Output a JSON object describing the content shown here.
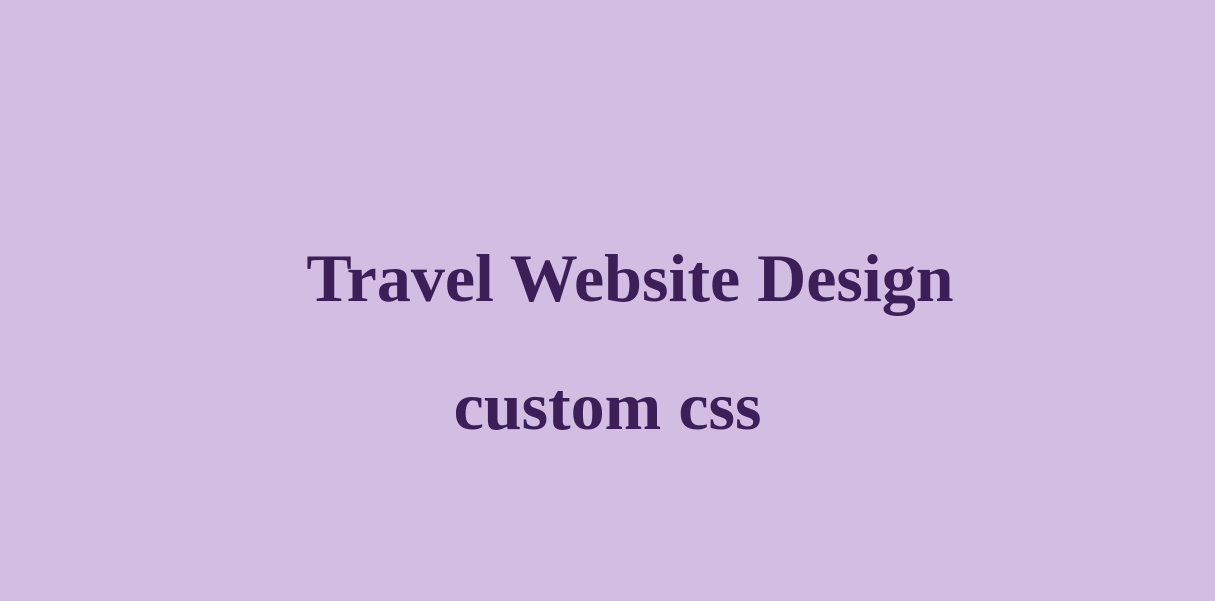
{
  "colors": {
    "background": "#d4bde3",
    "text": "#3c1f59"
  },
  "headline": {
    "line1": "Travel Website Design",
    "line2": "custom css"
  }
}
